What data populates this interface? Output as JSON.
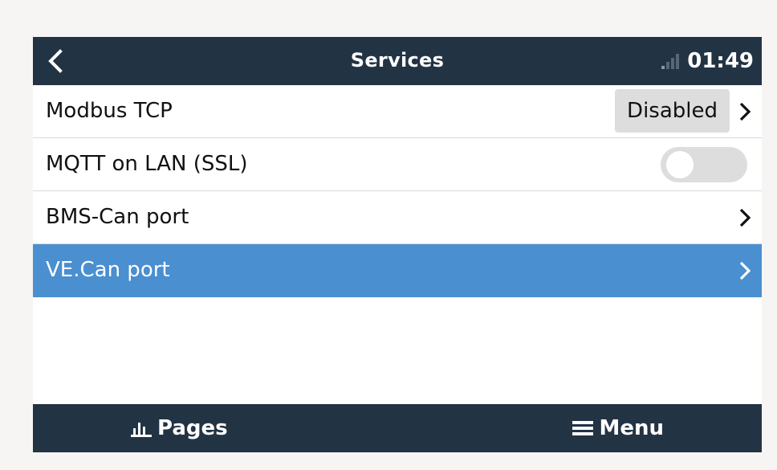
{
  "header": {
    "title": "Services",
    "time": "01:49",
    "signal_level": 1,
    "back_icon": "chevron-left-icon",
    "signal_icon": "signal-strength-icon"
  },
  "rows": [
    {
      "label": "Modbus TCP",
      "value": "Disabled",
      "control": "submenu-with-value"
    },
    {
      "label": "MQTT on LAN (SSL)",
      "control": "toggle",
      "toggle_on": false
    },
    {
      "label": "BMS-Can port",
      "control": "submenu"
    },
    {
      "label": "VE.Can port",
      "control": "submenu",
      "selected": true
    }
  ],
  "footer": {
    "pages_label": "Pages",
    "menu_label": "Menu",
    "pages_icon": "bar-chart-icon",
    "menu_icon": "hamburger-menu-icon"
  },
  "colors": {
    "bar_background": "#223344",
    "selected_row": "#4a8fd0",
    "value_box": "#dddddd",
    "page_background": "#f6f5f3"
  }
}
